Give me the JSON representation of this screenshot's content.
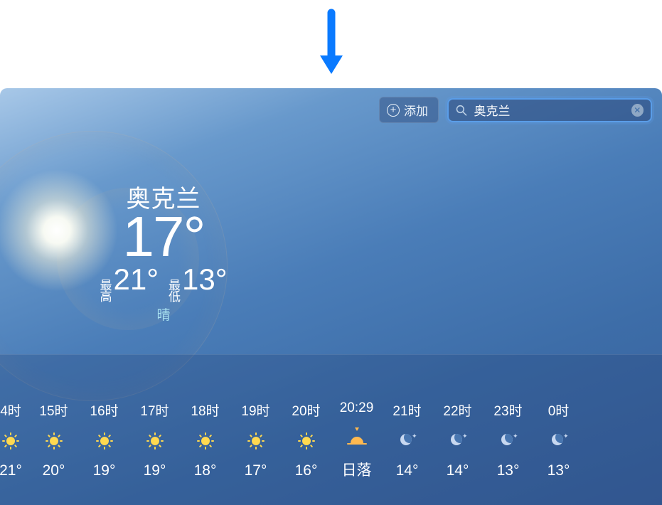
{
  "toolbar": {
    "add_label": "添加",
    "search_value": "奥克兰"
  },
  "current": {
    "location": "奥克兰",
    "temp": "17°",
    "high_label_1": "最",
    "high_label_2": "高",
    "high": "21°",
    "low_label_1": "最",
    "low_label_2": "低",
    "low": "13°",
    "condition": "晴"
  },
  "hourly": [
    {
      "time": "4时",
      "icon": "sun",
      "temp": "21°"
    },
    {
      "time": "15时",
      "icon": "sun",
      "temp": "20°"
    },
    {
      "time": "16时",
      "icon": "sun",
      "temp": "19°"
    },
    {
      "time": "17时",
      "icon": "sun",
      "temp": "19°"
    },
    {
      "time": "18时",
      "icon": "sun",
      "temp": "18°"
    },
    {
      "time": "19时",
      "icon": "sun",
      "temp": "17°"
    },
    {
      "time": "20时",
      "icon": "sun",
      "temp": "16°"
    },
    {
      "time": "20:29",
      "icon": "sunset",
      "temp": "日落"
    },
    {
      "time": "21时",
      "icon": "moon",
      "temp": "14°"
    },
    {
      "time": "22时",
      "icon": "moon",
      "temp": "14°"
    },
    {
      "time": "23时",
      "icon": "moon",
      "temp": "13°"
    },
    {
      "time": "0时",
      "icon": "moon",
      "temp": "13°"
    }
  ]
}
